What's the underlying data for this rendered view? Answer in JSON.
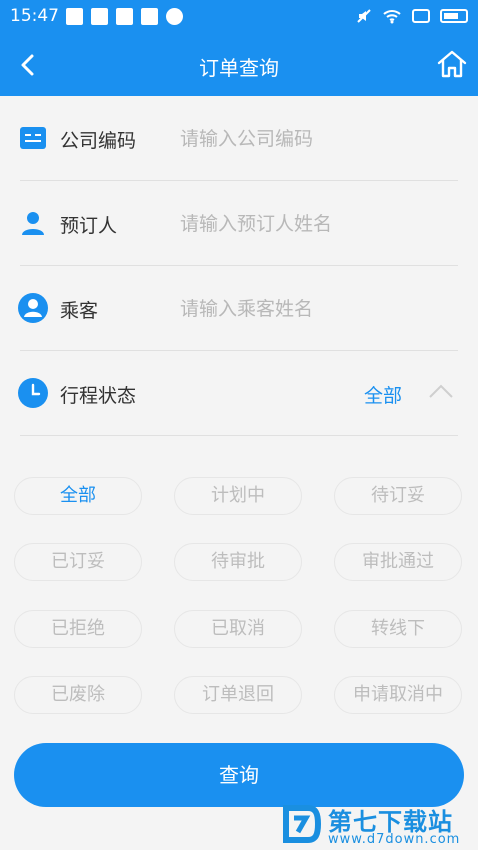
{
  "status_bar": {
    "time": "15:47"
  },
  "navbar": {
    "title": "订单查询",
    "back_icon": "chevron-left-icon",
    "home_icon": "home-icon"
  },
  "form": {
    "company_code": {
      "label": "公司编码",
      "placeholder": "请输入公司编码",
      "value": ""
    },
    "booker": {
      "label": "预订人",
      "placeholder": "请输入预订人姓名",
      "value": ""
    },
    "passenger": {
      "label": "乘客",
      "placeholder": "请输入乘客姓名",
      "value": ""
    },
    "trip_status": {
      "label": "行程状态",
      "selected": "全部"
    }
  },
  "status_options": [
    "全部",
    "计划中",
    "待订妥",
    "已订妥",
    "待审批",
    "审批通过",
    "已拒绝",
    "已取消",
    "转线下",
    "已废除",
    "订单退回",
    "申请取消中"
  ],
  "query_button": {
    "label": "查询"
  },
  "watermark": {
    "text": "第七下载站",
    "url": "www.d7down.com"
  },
  "colors": {
    "accent": "#1a90f0",
    "background": "#f4f4f4"
  }
}
